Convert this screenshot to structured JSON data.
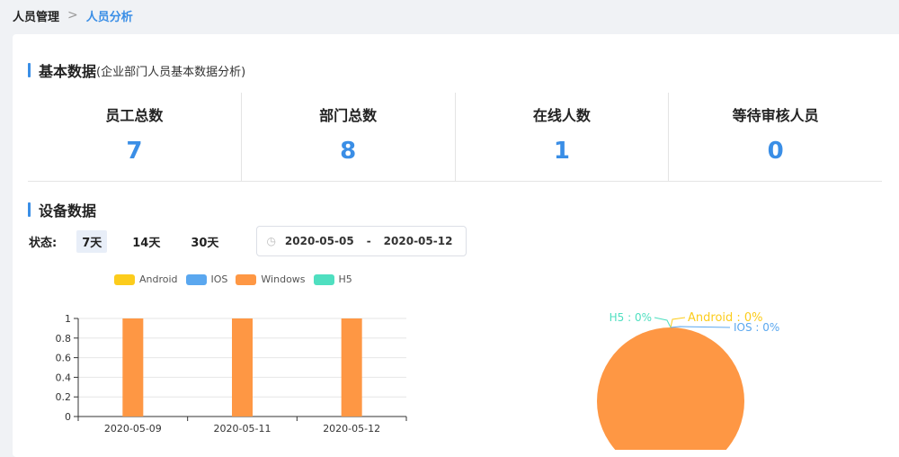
{
  "breadcrumb": {
    "home": "人员管理",
    "separator": ">",
    "current": "人员分析"
  },
  "basic": {
    "title": "基本数据",
    "subtitle": "(企业部门人员基本数据分析)",
    "stats": [
      {
        "label": "员工总数",
        "value": "7"
      },
      {
        "label": "部门总数",
        "value": "8"
      },
      {
        "label": "在线人数",
        "value": "1"
      },
      {
        "label": "等待审核人员",
        "value": "0"
      }
    ]
  },
  "device": {
    "title": "设备数据",
    "status_label": "状态:",
    "ranges": [
      "7天",
      "14天",
      "30天"
    ],
    "active_range": "7天",
    "date_start": "2020-05-05",
    "date_sep": "-",
    "date_end": "2020-05-12"
  },
  "chart_data": [
    {
      "type": "bar",
      "categories": [
        "2020-05-09",
        "2020-05-11",
        "2020-05-12"
      ],
      "series": [
        {
          "name": "Android",
          "color": "#fccc1c",
          "values": [
            0,
            0,
            0
          ]
        },
        {
          "name": "IOS",
          "color": "#5aa7ef",
          "values": [
            0,
            0,
            0
          ]
        },
        {
          "name": "Windows",
          "color": "#fe9744",
          "values": [
            1,
            1,
            1
          ]
        },
        {
          "name": "H5",
          "color": "#4fdfc0",
          "values": [
            0,
            0,
            0
          ]
        }
      ],
      "ylim": [
        0,
        1
      ],
      "yticks": [
        "0",
        "0.2",
        "0.4",
        "0.6",
        "0.8",
        "1"
      ],
      "legend": "top",
      "grid": true
    },
    {
      "type": "pie",
      "slices": [
        {
          "name": "H5",
          "value": 0,
          "label": "H5 : 0%",
          "color": "#4fdfc0"
        },
        {
          "name": "Android",
          "value": 0,
          "label": "Android : 0%",
          "color": "#fccc1c"
        },
        {
          "name": "IOS",
          "value": 0,
          "label": "IOS : 0%",
          "color": "#5aa7ef"
        },
        {
          "name": "Windows",
          "value": 100,
          "color": "#fe9744"
        }
      ]
    }
  ]
}
